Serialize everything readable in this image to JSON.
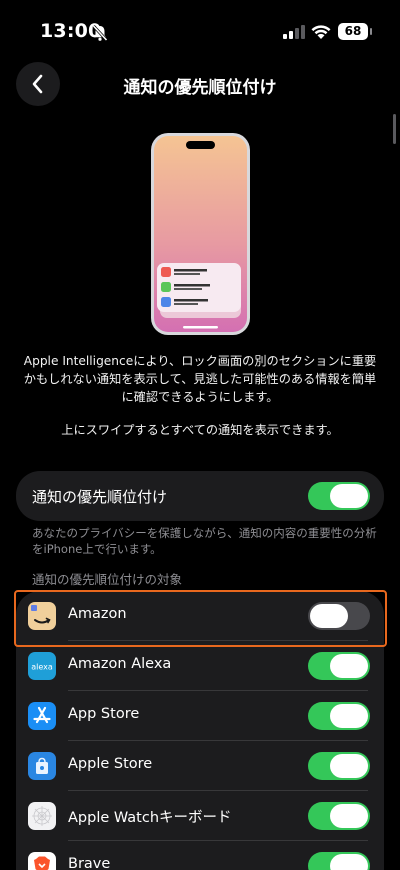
{
  "status_bar": {
    "time": "13:00",
    "battery": "68",
    "icons": [
      "bell-slash-icon",
      "signal-icon",
      "wifi-icon",
      "battery-icon"
    ]
  },
  "nav": {
    "back_icon": "chevron-left-icon",
    "title": "通知の優先順位付け"
  },
  "intro": {
    "description": "Apple Intelligenceにより、ロック画面の別のセクションに重要かもしれない通知を表示して、見逃した可能性のある情報を簡単に確認できるようにします。",
    "hint": "上にスワイプするとすべての通知を表示できます。"
  },
  "main_toggle": {
    "label": "通知の優先順位付け",
    "on": true
  },
  "footnote": "あなたのプライバシーを保護しながら、通知の内容の重要性の分析をiPhone上で行います。",
  "section_header": "通知の優先順位付けの対象",
  "apps": [
    {
      "name": "Amazon",
      "icon": "amazon-app-icon",
      "on": false
    },
    {
      "name": "Amazon Alexa",
      "icon": "alexa-app-icon",
      "icon_text": "alexa",
      "on": true
    },
    {
      "name": "App Store",
      "icon": "app-store-icon",
      "on": true
    },
    {
      "name": "Apple Store",
      "icon": "apple-store-icon",
      "on": true
    },
    {
      "name": "Apple Watchキーボード",
      "icon": "apple-watch-keyboard-icon",
      "on": true
    },
    {
      "name": "Brave",
      "icon": "brave-icon",
      "on": true
    }
  ],
  "colors": {
    "accent_green": "#34c759",
    "highlight_orange": "#e8681e",
    "card_bg": "#1c1c1e"
  }
}
